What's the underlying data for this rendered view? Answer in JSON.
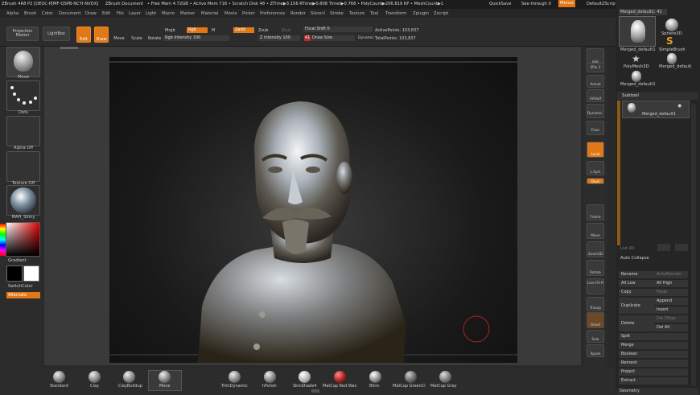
{
  "titlebar": {
    "app": "ZBrush 4R8 P2 [DEUC-P[MF-QSPB-NCYI-NVDX]",
    "document": "ZBrush Document",
    "stats": "• Free Mem 4.72GB • Active Mem 716 • Scratch Disk 48 • ZTime▶3.156 RTime▶0.808 Timer▶0.768 • PolyCount▶206.819 KP • MeshCount▶1",
    "quicksave": "QuickSave",
    "seethrough": "See-through  0",
    "menus": "Menus",
    "script": "DefaultZScript"
  },
  "menubar": {
    "items": [
      "Alpha",
      "Brush",
      "Color",
      "Document",
      "Draw",
      "Edit",
      "File",
      "Layer",
      "Light",
      "Macro",
      "Marker",
      "Material",
      "Movie",
      "Picker",
      "Preferences",
      "Render",
      "Stencil",
      "Stroke",
      "Texture",
      "Tool",
      "Transform",
      "Zplugin",
      "Zscript"
    ]
  },
  "toolbar": {
    "projection_master": "Projection Master",
    "lightbox": "LightBox",
    "edit": "Edit",
    "draw": "Draw",
    "move": "Move",
    "scale": "Scale",
    "rotate": "Rotate",
    "mrgb": "Mrgb",
    "rgb": "Rgb",
    "m": "M",
    "rgb_intensity": "Rgb Intensity 100",
    "zadd": "Zadd",
    "zsub": "Zsub",
    "zcut": "Zcut",
    "z_intensity": "Z Intensity 100",
    "focal_shift": "Focal Shift 0",
    "draw_size_value": "41",
    "draw_size": "Draw Size",
    "dynamic": "Dynamic",
    "active_points": "ActivePoints: 103,837",
    "total_points": "TotalPoints: 103,837"
  },
  "leftshelf": {
    "items": [
      "Move",
      "Dots",
      "Alpha Off",
      "Texture Off",
      "MAH_Shiny"
    ],
    "gradient": "Gradient",
    "switchcolor": "SwitchColor",
    "alternate": "Alternate"
  },
  "rightshelf": {
    "items": [
      "BPR",
      "SPix 3",
      "Actual",
      "AAHalf",
      "Dynamic Persp",
      "Floor",
      "Local",
      "L.Sym",
      "Qxyz",
      "",
      "Frame",
      "Move",
      "Zoom3D",
      "Rotate",
      "Line Fill PolyF",
      "Transp",
      "Ghost",
      "Solo",
      "Xpose"
    ]
  },
  "tray": {
    "tool_name": "Merged_default1: 41",
    "tools": [
      "Merged_default1",
      "Sphere3D",
      "SimpleBrush",
      "PolyMesh3D",
      "Merged_default",
      "Merged_default1"
    ],
    "subtool_header": "Subtool",
    "subtool_item": "Merged_default1",
    "list_all": "List All",
    "auto_collapse": "Auto Collapse",
    "rename": "Rename",
    "autoreorder": "AutoReorder",
    "all_low": "All Low",
    "all_high": "All High",
    "copy": "Copy",
    "paste": "Paste",
    "duplicate": "Duplicate",
    "append": "Append",
    "insert": "Insert",
    "delete": "Delete",
    "del_other": "Del Other",
    "del_all": "Del All",
    "split": "Split",
    "merge": "Merge",
    "boolean": "Boolean",
    "remesh": "Remesh",
    "project": "Project",
    "extract": "Extract",
    "geometry": "Geometry"
  },
  "bottombar": {
    "brushes": [
      "Standard",
      "Clay",
      "ClayBuildup",
      "Move",
      "TrimDynamic",
      "hPolish"
    ],
    "materials": [
      "SkinShade4",
      "MatCap Red Wax",
      "Blinn",
      "MatCap GreenCl",
      "MatCap Gray"
    ]
  },
  "colors": {
    "accent": "#e07818",
    "background": "#2a2a2a"
  }
}
